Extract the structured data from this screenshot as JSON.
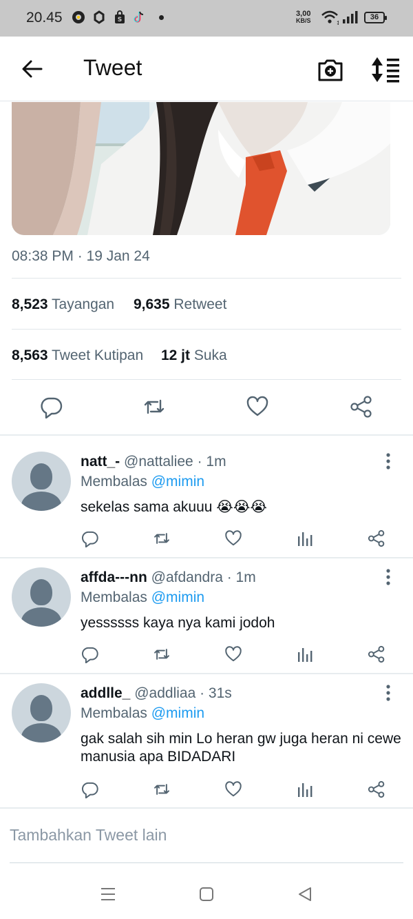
{
  "status_bar": {
    "time": "20.45",
    "speed_value": "3,00",
    "speed_unit": "KB/S",
    "battery": "36"
  },
  "header": {
    "title": "Tweet"
  },
  "tweet": {
    "timestamp": "08:38 PM · 19 Jan 24",
    "views_count": "8,523",
    "views_label": "Tayangan",
    "retweets_count": "9,635",
    "retweets_label": "Retweet",
    "quotes_count": "8,563",
    "quotes_label": "Tweet Kutipan",
    "likes_count": "12 jt",
    "likes_label": "Suka"
  },
  "replies": [
    {
      "name": "natt_-",
      "handle": "@nattaliee · 1m",
      "replying_label": "Membalas",
      "replying_to": "@mimin",
      "text": "sekelas sama akuuu 😭😭😭"
    },
    {
      "name": "affda---nn",
      "handle": "@afdandra · 1m",
      "replying_label": "Membalas",
      "replying_to": "@mimin",
      "text": "yessssss kaya nya kami jodoh"
    },
    {
      "name": "addlle_",
      "handle": "@addliaa · 31s",
      "replying_label": "Membalas",
      "replying_to": "@mimin",
      "text": "gak salah sih min Lo heran gw juga heran ni cewe manusia apa BIDADARI"
    }
  ],
  "compose": {
    "placeholder": "Tambahkan Tweet lain"
  },
  "colors": {
    "accent": "#1d9bf0",
    "secondary_text": "#536471",
    "status_bar_bg": "#c8c8c8"
  }
}
